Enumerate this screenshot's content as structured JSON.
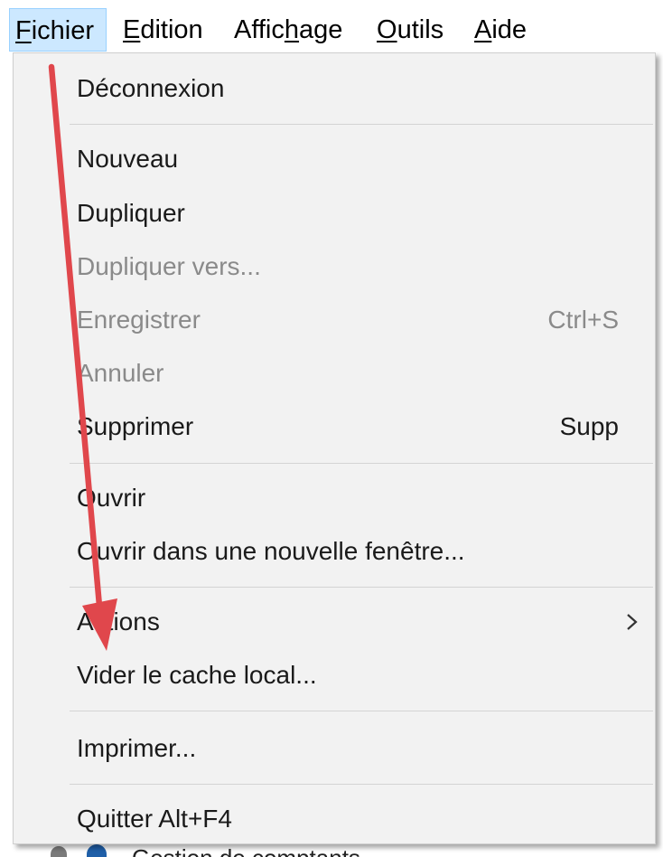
{
  "menubar": {
    "items": [
      {
        "label": "Fichier",
        "accel": "F",
        "active": true
      },
      {
        "label": "Edition",
        "accel": "E"
      },
      {
        "label": "Affichage",
        "accel": "h"
      },
      {
        "label": "Outils",
        "accel": "O"
      },
      {
        "label": "Aide",
        "accel": "A"
      }
    ]
  },
  "menu": {
    "items": [
      {
        "label": "Déconnexion",
        "enabled": true
      },
      {
        "label": "Nouveau",
        "enabled": true
      },
      {
        "label": "Dupliquer",
        "enabled": true
      },
      {
        "label": "Dupliquer vers...",
        "enabled": false
      },
      {
        "label": "Enregistrer",
        "enabled": false,
        "shortcut": "Ctrl+S"
      },
      {
        "label": "Annuler",
        "enabled": false
      },
      {
        "label": "Supprimer",
        "enabled": true,
        "shortcut": "Supp"
      },
      {
        "label": "Ouvrir",
        "enabled": true
      },
      {
        "label": "Ouvrir dans une nouvelle fenêtre...",
        "enabled": true
      },
      {
        "label": "Actions",
        "enabled": true,
        "submenu": true
      },
      {
        "label": "Vider le cache local...",
        "enabled": true
      },
      {
        "label": "Imprimer...",
        "enabled": true
      },
      {
        "label": "Quitter  Alt+F4",
        "enabled": true
      }
    ]
  },
  "underlay": {
    "text": "Gestion de comptants"
  },
  "colors": {
    "menubar_active_bg": "#cce8ff",
    "menubar_active_border": "#99d1ff",
    "menu_bg": "#f2f2f2",
    "disabled_text": "#8a8a8a",
    "separator": "#d4d4d4",
    "annotation_arrow": "#e0474c"
  },
  "icons": {
    "submenu_indicator": "chevron-right-icon",
    "annotation": "red-arrow-annotation"
  }
}
